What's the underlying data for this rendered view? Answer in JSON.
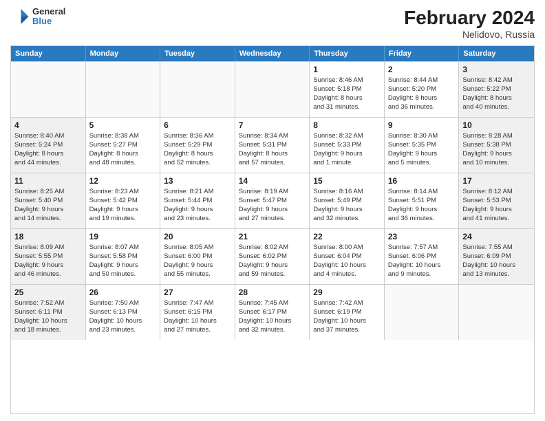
{
  "header": {
    "logo": {
      "line1": "General",
      "line2": "Blue"
    },
    "title": "February 2024",
    "subtitle": "Nelidovo, Russia"
  },
  "weekdays": [
    "Sunday",
    "Monday",
    "Tuesday",
    "Wednesday",
    "Thursday",
    "Friday",
    "Saturday"
  ],
  "rows": [
    [
      {
        "day": "",
        "lines": [],
        "empty": true
      },
      {
        "day": "",
        "lines": [],
        "empty": true
      },
      {
        "day": "",
        "lines": [],
        "empty": true
      },
      {
        "day": "",
        "lines": [],
        "empty": true
      },
      {
        "day": "1",
        "lines": [
          "Sunrise: 8:46 AM",
          "Sunset: 5:18 PM",
          "Daylight: 8 hours",
          "and 31 minutes."
        ],
        "empty": false
      },
      {
        "day": "2",
        "lines": [
          "Sunrise: 8:44 AM",
          "Sunset: 5:20 PM",
          "Daylight: 8 hours",
          "and 36 minutes."
        ],
        "empty": false
      },
      {
        "day": "3",
        "lines": [
          "Sunrise: 8:42 AM",
          "Sunset: 5:22 PM",
          "Daylight: 8 hours",
          "and 40 minutes."
        ],
        "empty": false,
        "shaded": true
      }
    ],
    [
      {
        "day": "4",
        "lines": [
          "Sunrise: 8:40 AM",
          "Sunset: 5:24 PM",
          "Daylight: 8 hours",
          "and 44 minutes."
        ],
        "empty": false,
        "shaded": true
      },
      {
        "day": "5",
        "lines": [
          "Sunrise: 8:38 AM",
          "Sunset: 5:27 PM",
          "Daylight: 8 hours",
          "and 48 minutes."
        ],
        "empty": false
      },
      {
        "day": "6",
        "lines": [
          "Sunrise: 8:36 AM",
          "Sunset: 5:29 PM",
          "Daylight: 8 hours",
          "and 52 minutes."
        ],
        "empty": false
      },
      {
        "day": "7",
        "lines": [
          "Sunrise: 8:34 AM",
          "Sunset: 5:31 PM",
          "Daylight: 8 hours",
          "and 57 minutes."
        ],
        "empty": false
      },
      {
        "day": "8",
        "lines": [
          "Sunrise: 8:32 AM",
          "Sunset: 5:33 PM",
          "Daylight: 9 hours",
          "and 1 minute."
        ],
        "empty": false
      },
      {
        "day": "9",
        "lines": [
          "Sunrise: 8:30 AM",
          "Sunset: 5:35 PM",
          "Daylight: 9 hours",
          "and 5 minutes."
        ],
        "empty": false
      },
      {
        "day": "10",
        "lines": [
          "Sunrise: 8:28 AM",
          "Sunset: 5:38 PM",
          "Daylight: 9 hours",
          "and 10 minutes."
        ],
        "empty": false,
        "shaded": true
      }
    ],
    [
      {
        "day": "11",
        "lines": [
          "Sunrise: 8:25 AM",
          "Sunset: 5:40 PM",
          "Daylight: 9 hours",
          "and 14 minutes."
        ],
        "empty": false,
        "shaded": true
      },
      {
        "day": "12",
        "lines": [
          "Sunrise: 8:23 AM",
          "Sunset: 5:42 PM",
          "Daylight: 9 hours",
          "and 19 minutes."
        ],
        "empty": false
      },
      {
        "day": "13",
        "lines": [
          "Sunrise: 8:21 AM",
          "Sunset: 5:44 PM",
          "Daylight: 9 hours",
          "and 23 minutes."
        ],
        "empty": false
      },
      {
        "day": "14",
        "lines": [
          "Sunrise: 8:19 AM",
          "Sunset: 5:47 PM",
          "Daylight: 9 hours",
          "and 27 minutes."
        ],
        "empty": false
      },
      {
        "day": "15",
        "lines": [
          "Sunrise: 8:16 AM",
          "Sunset: 5:49 PM",
          "Daylight: 9 hours",
          "and 32 minutes."
        ],
        "empty": false
      },
      {
        "day": "16",
        "lines": [
          "Sunrise: 8:14 AM",
          "Sunset: 5:51 PM",
          "Daylight: 9 hours",
          "and 36 minutes."
        ],
        "empty": false
      },
      {
        "day": "17",
        "lines": [
          "Sunrise: 8:12 AM",
          "Sunset: 5:53 PM",
          "Daylight: 9 hours",
          "and 41 minutes."
        ],
        "empty": false,
        "shaded": true
      }
    ],
    [
      {
        "day": "18",
        "lines": [
          "Sunrise: 8:09 AM",
          "Sunset: 5:55 PM",
          "Daylight: 9 hours",
          "and 46 minutes."
        ],
        "empty": false,
        "shaded": true
      },
      {
        "day": "19",
        "lines": [
          "Sunrise: 8:07 AM",
          "Sunset: 5:58 PM",
          "Daylight: 9 hours",
          "and 50 minutes."
        ],
        "empty": false
      },
      {
        "day": "20",
        "lines": [
          "Sunrise: 8:05 AM",
          "Sunset: 6:00 PM",
          "Daylight: 9 hours",
          "and 55 minutes."
        ],
        "empty": false
      },
      {
        "day": "21",
        "lines": [
          "Sunrise: 8:02 AM",
          "Sunset: 6:02 PM",
          "Daylight: 9 hours",
          "and 59 minutes."
        ],
        "empty": false
      },
      {
        "day": "22",
        "lines": [
          "Sunrise: 8:00 AM",
          "Sunset: 6:04 PM",
          "Daylight: 10 hours",
          "and 4 minutes."
        ],
        "empty": false
      },
      {
        "day": "23",
        "lines": [
          "Sunrise: 7:57 AM",
          "Sunset: 6:06 PM",
          "Daylight: 10 hours",
          "and 9 minutes."
        ],
        "empty": false
      },
      {
        "day": "24",
        "lines": [
          "Sunrise: 7:55 AM",
          "Sunset: 6:09 PM",
          "Daylight: 10 hours",
          "and 13 minutes."
        ],
        "empty": false,
        "shaded": true
      }
    ],
    [
      {
        "day": "25",
        "lines": [
          "Sunrise: 7:52 AM",
          "Sunset: 6:11 PM",
          "Daylight: 10 hours",
          "and 18 minutes."
        ],
        "empty": false,
        "shaded": true
      },
      {
        "day": "26",
        "lines": [
          "Sunrise: 7:50 AM",
          "Sunset: 6:13 PM",
          "Daylight: 10 hours",
          "and 23 minutes."
        ],
        "empty": false
      },
      {
        "day": "27",
        "lines": [
          "Sunrise: 7:47 AM",
          "Sunset: 6:15 PM",
          "Daylight: 10 hours",
          "and 27 minutes."
        ],
        "empty": false
      },
      {
        "day": "28",
        "lines": [
          "Sunrise: 7:45 AM",
          "Sunset: 6:17 PM",
          "Daylight: 10 hours",
          "and 32 minutes."
        ],
        "empty": false
      },
      {
        "day": "29",
        "lines": [
          "Sunrise: 7:42 AM",
          "Sunset: 6:19 PM",
          "Daylight: 10 hours",
          "and 37 minutes."
        ],
        "empty": false
      },
      {
        "day": "",
        "lines": [],
        "empty": true
      },
      {
        "day": "",
        "lines": [],
        "empty": true,
        "shaded": true
      }
    ]
  ]
}
